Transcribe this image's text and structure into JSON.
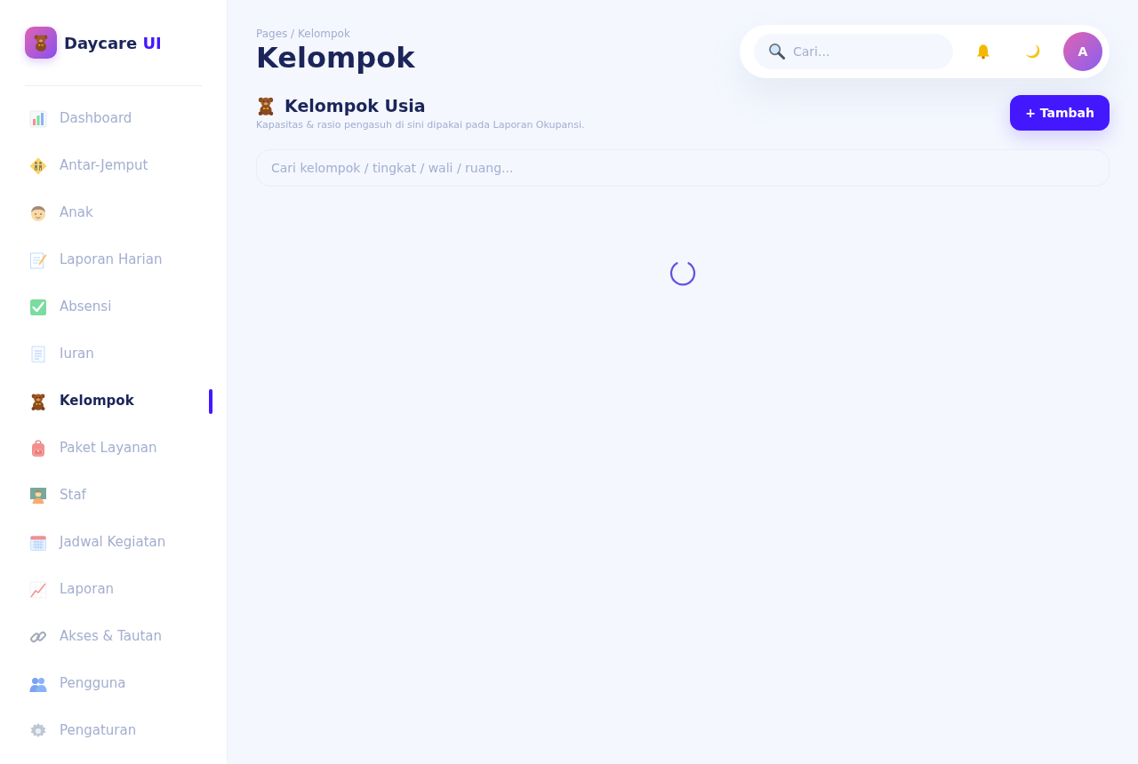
{
  "sidebar": {
    "brand": {
      "name": "Daycare",
      "accent": "UI"
    },
    "items": [
      {
        "label": "Dashboard",
        "selected": false
      },
      {
        "label": "Antar-Jemput",
        "selected": false
      },
      {
        "label": "Anak",
        "selected": false
      },
      {
        "label": "Laporan Harian",
        "selected": false
      },
      {
        "label": "Absensi",
        "selected": false
      },
      {
        "label": "Iuran",
        "selected": false
      },
      {
        "label": "Kelompok",
        "selected": true
      },
      {
        "label": "Paket Layanan",
        "selected": false
      },
      {
        "label": "Staf",
        "selected": false
      },
      {
        "label": "Jadwal Kegiatan",
        "selected": false
      },
      {
        "label": "Laporan",
        "selected": false
      },
      {
        "label": "Akses & Tautan",
        "selected": false
      },
      {
        "label": "Pengguna",
        "selected": false
      },
      {
        "label": "Pengaturan",
        "selected": false
      }
    ]
  },
  "header": {
    "breadcrumb": "Pages / Kelompok",
    "title": "Kelompok",
    "search": {
      "placeholder": "Cari..."
    },
    "avatar": {
      "initial": "A"
    }
  },
  "section": {
    "title": "Kelompok Usia",
    "subtitle": "Kapasitas & rasio pengasuh di sini dipakai pada Laporan Okupansi.",
    "add_button": "+ Tambah",
    "filter": {
      "placeholder": "Cari kelompok / tingkat / wali / ruang..."
    },
    "loading": true
  }
}
